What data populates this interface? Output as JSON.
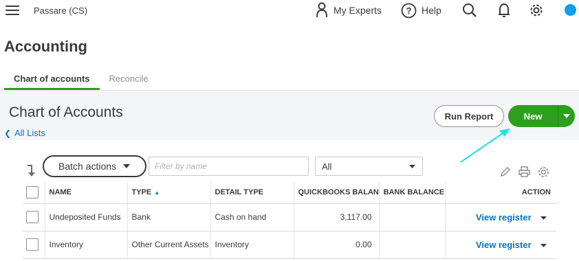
{
  "header": {
    "company": "Passare (CS)",
    "my_experts": "My Experts",
    "help": "Help"
  },
  "page": {
    "title": "Accounting",
    "tabs": [
      {
        "label": "Chart of accounts",
        "active": true
      },
      {
        "label": "Reconcile",
        "active": false
      }
    ]
  },
  "panel": {
    "title": "Chart of Accounts",
    "all_lists": "All Lists",
    "run_report": "Run Report",
    "new_label": "New"
  },
  "toolbar": {
    "batch_actions": "Batch actions",
    "filter_placeholder": "Filter by name",
    "select_value": "All"
  },
  "table": {
    "columns": [
      "NAME",
      "TYPE",
      "DETAIL TYPE",
      "QUICKBOOKS BALANCE",
      "BANK BALANCE",
      "ACTION"
    ],
    "rows": [
      {
        "name": "Undeposited Funds",
        "type": "Bank",
        "detail_type": "Cash on hand",
        "qb_balance": "3,117.00",
        "bank_balance": "",
        "action": "View register"
      },
      {
        "name": "Inventory",
        "type": "Other Current Assets",
        "detail_type": "Inventory",
        "qb_balance": "0.00",
        "bank_balance": "",
        "action": "View register"
      }
    ]
  },
  "colors": {
    "accent_green": "#2ca01c",
    "link_blue": "#0077c5",
    "annotation_cyan": "#19e6e6"
  }
}
